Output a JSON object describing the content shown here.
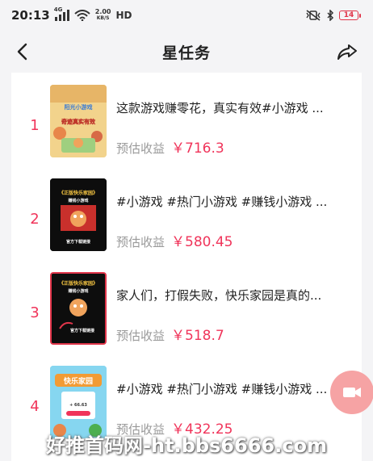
{
  "status_bar": {
    "time": "20:13",
    "signal_label": "4G",
    "speed_value": "2.00",
    "speed_unit": "KB/S",
    "hd": "HD",
    "battery": "14"
  },
  "nav": {
    "title": "星任务"
  },
  "tasks": [
    {
      "rank": "1",
      "title": "这款游戏赚零花，真实有效#小游戏 ...",
      "est_label": "预估收益",
      "est_value": "￥716.3",
      "thumb_text_top": "阳光小游戏",
      "thumb_text_mid": "奇迹真实有效",
      "thumb_bg": "#f4dca0"
    },
    {
      "rank": "2",
      "title": "#小游戏 #热门小游戏 #赚钱小游戏 ...",
      "est_label": "预估收益",
      "est_value": "￥580.45",
      "thumb_text_top": "《正版快乐家园》",
      "thumb_text_mid": "赚钱小游戏",
      "thumb_text_bottom": "官方下载链接",
      "thumb_bg": "#111111"
    },
    {
      "rank": "3",
      "title": "家人们，打假失败，快乐家园是真的...",
      "est_label": "预估收益",
      "est_value": "￥518.7",
      "thumb_text_top": "《正版快乐家园》",
      "thumb_text_mid": "赚钱小游戏",
      "thumb_text_bottom": "官方下载链接",
      "thumb_bg": "#111111"
    },
    {
      "rank": "4",
      "title": "#小游戏 #热门小游戏 #赚钱小游戏 ...",
      "est_label": "预估收益",
      "est_value": "￥432.25",
      "thumb_text_top": "快乐家园",
      "thumb_text_mid": "+ 66.63",
      "thumb_bg": "#7fd3ef"
    }
  ],
  "watermark": "好推首码网-ht.bbs6666.com",
  "colors": {
    "accent": "#f0345a",
    "page_bg": "#f4f4f6",
    "card_bg": "#ffffff",
    "muted_text": "#9a9a9a",
    "fab": "#f6a3a4"
  }
}
